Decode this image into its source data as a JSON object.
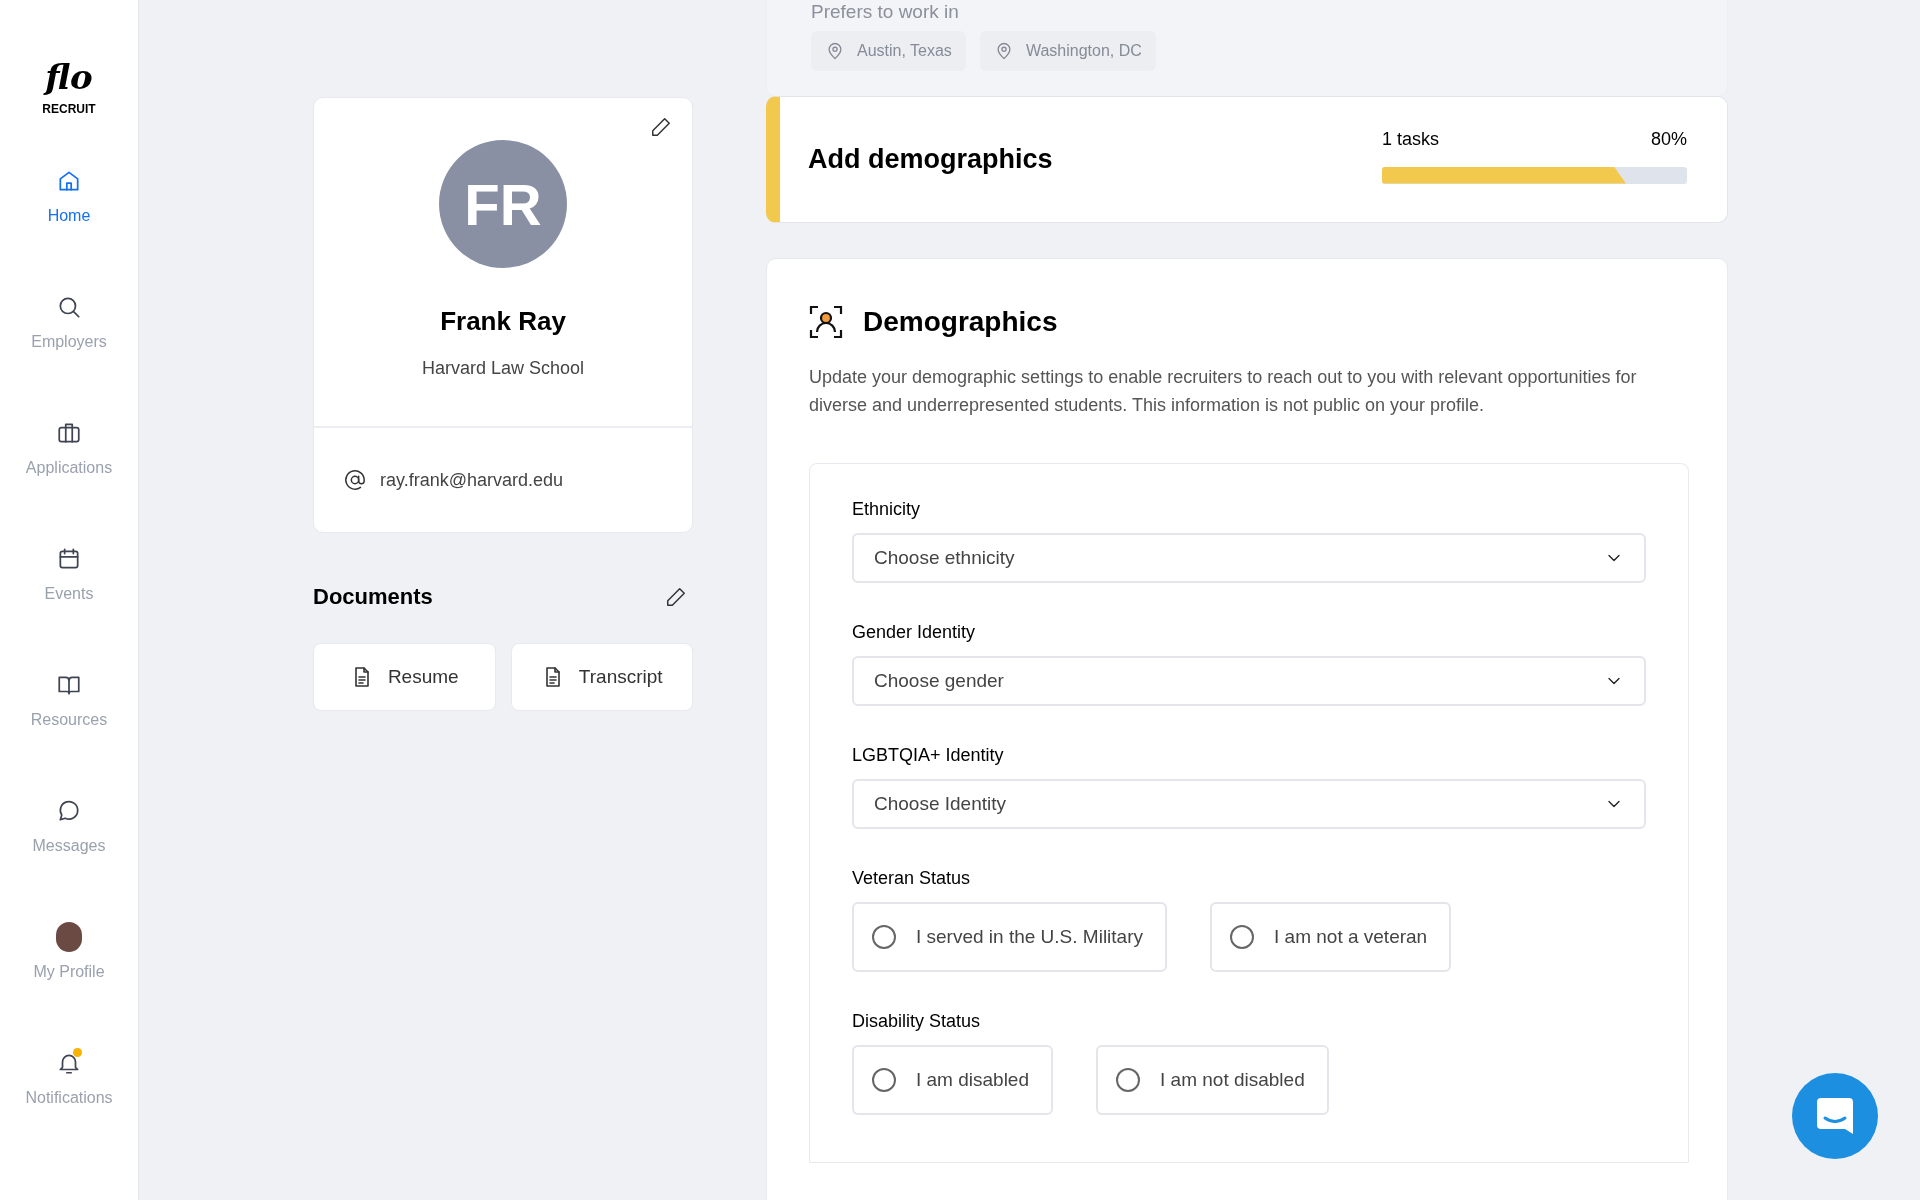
{
  "sidebar": {
    "logo": {
      "script": "flo",
      "word": "RECRUIT"
    },
    "items": [
      {
        "label": "Home",
        "selected": true,
        "alert": false
      },
      {
        "label": "Employers",
        "selected": false,
        "alert": false
      },
      {
        "label": "Applications",
        "selected": false,
        "alert": false
      },
      {
        "label": "Events",
        "selected": false,
        "alert": false
      },
      {
        "label": "Resources",
        "selected": false,
        "alert": false
      },
      {
        "label": "Messages",
        "selected": false,
        "alert": false
      },
      {
        "label": "My Profile",
        "selected": false,
        "alert": false
      },
      {
        "label": "Notifications",
        "selected": false,
        "alert": true
      }
    ]
  },
  "profile": {
    "initials": "FR",
    "name": "Frank Ray",
    "school": "Harvard Law School",
    "email": "ray.frank@harvard.edu"
  },
  "documents": {
    "title": "Documents",
    "files": [
      "Resume",
      "Transcript"
    ]
  },
  "preferences": {
    "label": "Prefers to work in",
    "locations": [
      "Austin, Texas",
      "Washington, DC"
    ]
  },
  "task": {
    "title": "Add demographics",
    "count": "1 tasks",
    "percent": "80%",
    "level": 0.8
  },
  "demographics": {
    "title": "Demographics",
    "description": "Update your demographic settings to enable recruiters to reach out to you with relevant opportunities for diverse and underrepresented students. This information is not public on your profile.",
    "fields": [
      {
        "kind": "select",
        "label": "Ethnicity",
        "placeholder": "Choose ethnicity"
      },
      {
        "kind": "select",
        "label": "Gender Identity",
        "placeholder": "Choose gender"
      },
      {
        "kind": "select",
        "label": "LGBTQIA+ Identity",
        "placeholder": "Choose Identity"
      },
      {
        "kind": "radio",
        "label": "Veteran Status",
        "options": [
          {
            "label": "I served in the U.S. Military",
            "selected": false
          },
          {
            "label": "I am not a veteran",
            "selected": false
          }
        ]
      },
      {
        "kind": "radio",
        "label": "Disability Status",
        "options": [
          {
            "label": "I am disabled",
            "selected": false
          },
          {
            "label": "I am not disabled",
            "selected": false
          }
        ]
      }
    ]
  }
}
